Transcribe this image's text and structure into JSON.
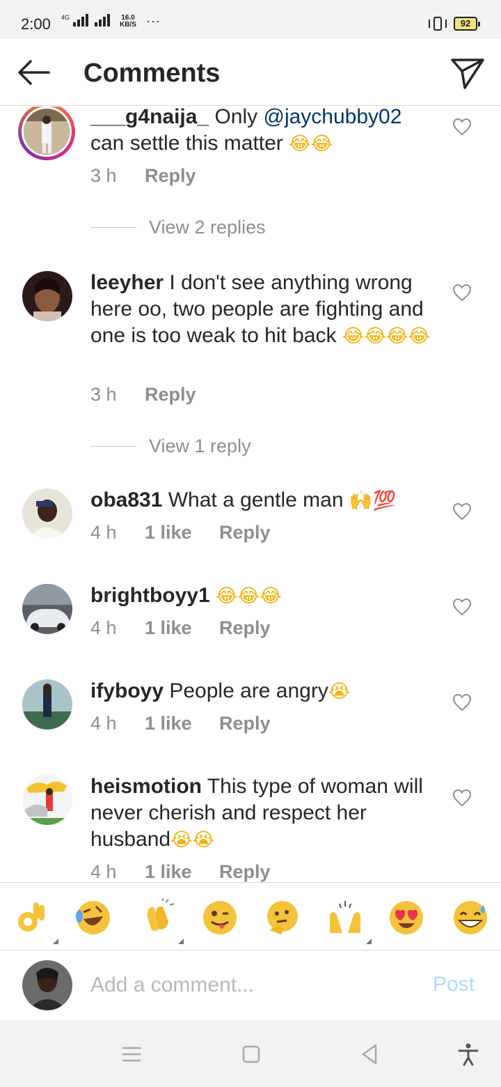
{
  "status_bar": {
    "time": "2:00",
    "network": "4G",
    "speed_value": "16.0",
    "speed_unit": "KB/S",
    "more": "···",
    "battery": "92"
  },
  "header": {
    "title": "Comments",
    "back_icon": "arrow-left-icon",
    "send_icon": "paper-plane-icon"
  },
  "comments": [
    {
      "username": "___g4naija_",
      "text_before": " Only ",
      "mention": "@jaychubby02",
      "text_after": " can settle this matter ",
      "emoji": "😂😂",
      "time": "3 h",
      "likes": "",
      "reply": "Reply",
      "view_replies": "View 2 replies"
    },
    {
      "username": "leeyher",
      "text": " I don't see anything wrong here oo, two people are fighting and one is too weak to hit back ",
      "emoji": "😂😂😂😂",
      "time": "3 h",
      "likes": "",
      "reply": "Reply",
      "view_replies": "View 1 reply"
    },
    {
      "username": "oba831",
      "text": " What a gentle man ",
      "emoji": "🙌💯",
      "time": "4 h",
      "likes": "1 like",
      "reply": "Reply"
    },
    {
      "username": "brightboyy1",
      "text": " ",
      "emoji": "😂😂😂",
      "time": "4 h",
      "likes": "1 like",
      "reply": "Reply"
    },
    {
      "username": "ifyboyy",
      "text": " People are angry",
      "emoji": "😭",
      "time": "4 h",
      "likes": "1 like",
      "reply": "Reply"
    },
    {
      "username": "heismotion",
      "text": " This type of woman will never cherish and respect her husband",
      "emoji": "😭😭",
      "time": "4 h",
      "likes": "1 like",
      "reply": "Reply"
    }
  ],
  "emoji_bar": [
    "ok-hand-icon",
    "rofl-icon",
    "clapping-hands-icon",
    "winking-tongue-icon",
    "thinking-face-icon",
    "raising-hands-icon",
    "heart-eyes-icon",
    "grinning-sweat-icon"
  ],
  "composer": {
    "placeholder": "Add a comment...",
    "post_label": "Post"
  },
  "colors": {
    "mention": "#003569",
    "meta_gray": "#8e8e8e",
    "post_disabled": "#b3dbff",
    "emoji_yellow": "#f5c33b"
  }
}
